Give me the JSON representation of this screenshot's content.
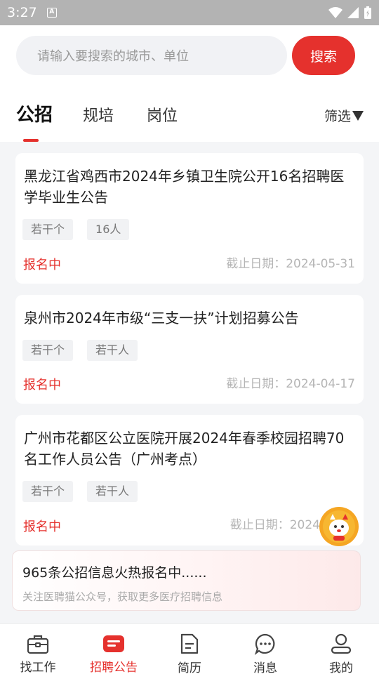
{
  "status_bar": {
    "time": "3:27",
    "a_icon_label": "A"
  },
  "search": {
    "placeholder": "请输入要搜索的城市、单位",
    "button_label": "搜索"
  },
  "tabs": [
    {
      "label": "公招",
      "active": true
    },
    {
      "label": "规培",
      "active": false
    },
    {
      "label": "岗位",
      "active": false
    }
  ],
  "filter_label": "筛选",
  "listings": [
    {
      "title": "黑龙江省鸡西市2024年乡镇卫生院公开16名招聘医学毕业生公告",
      "tags": [
        "若干个",
        "16人"
      ],
      "status": "报名中",
      "deadline": "截止日期：2024-05-31"
    },
    {
      "title": "泉州市2024年市级“三支一扶”计划招募公告",
      "tags": [
        "若干个",
        "若干人"
      ],
      "status": "报名中",
      "deadline": "截止日期：2024-04-17"
    },
    {
      "title": "广州市花都区公立医院开展2024年春季校园招聘70名工作人员公告（广州考点）",
      "tags": [
        "若干个",
        "若干人"
      ],
      "status": "报名中",
      "deadline": "截止日期：2024"
    }
  ],
  "promo": {
    "title": "965条公招信息火热报名中......",
    "subtitle": "关注医聘猫公众号，获取更多医疗招聘信息"
  },
  "bottom_nav": [
    {
      "label": "找工作",
      "icon": "briefcase-icon",
      "active": false
    },
    {
      "label": "招聘公告",
      "icon": "announcement-icon",
      "active": true
    },
    {
      "label": "简历",
      "icon": "document-icon",
      "active": false
    },
    {
      "label": "消息",
      "icon": "chat-icon",
      "active": false
    },
    {
      "label": "我的",
      "icon": "user-icon",
      "active": false
    }
  ],
  "colors": {
    "accent": "#e5312d",
    "status_bar": "#b3b3b3",
    "background": "#f4f5f7"
  }
}
